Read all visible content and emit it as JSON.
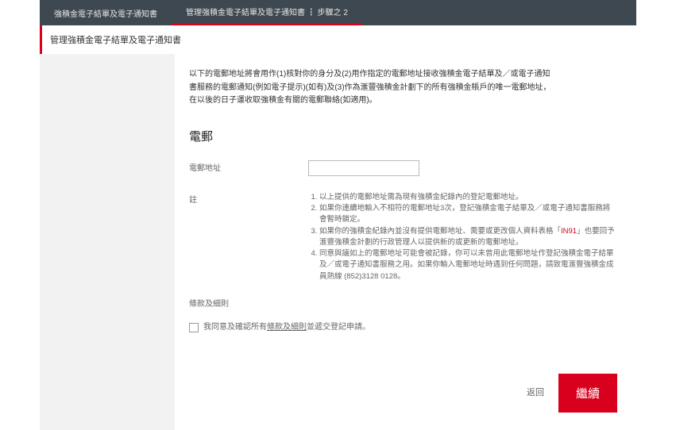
{
  "tabs": [
    {
      "label": "強積金電子結單及電子通知書"
    },
    {
      "label": "管理強積金電子結單及電子通知書 ┇ 步驟之 2"
    }
  ],
  "subheader": "管理強積金電子結單及電子通知書",
  "intro": {
    "line1": "以下的電郵地址將會用作(1)核對你的身分及(2)用作指定的電郵地址接收強積金電子結單及／或電子通知",
    "line2": "書服務的電郵通知(例如電子提示)(如有)及(3)作為滙豐強積金計劃下的所有強積金賬戶的唯一電郵地址，",
    "line3": "在以後的日子運收取強積金有關的電郵聯絡(如適用)。"
  },
  "section_title": "電郵",
  "email_label": "電郵地址",
  "email_value": "",
  "note_label": "註",
  "notes": {
    "n1": "以上提供的電郵地址需為現有強積金紀錄內的登記電郵地址。",
    "n2": "如果你連續地輸入不相符的電郵地址3次，登記強積金電子結單及／或電子通知書服務將會暫時鎖定。",
    "n3_a": "如果你的強積金紀錄內並沒有提供電郵地址、需要或更改個人資料表格「",
    "n3_link": "IN91",
    "n3_b": "」也要回予滙豐強積金計劃的行政管理人以提供新的或更新的電郵地址。",
    "n4": "同意與議如上的電郵地址可能會被記錄，你可以未曾用此電郵地址作登記強積金電子結單及／或電子通知書服務之用。如果你輸入電郵地址時遇到任何問題，請致電滙豐強積金成員熱線 (852)3128 0128。"
  },
  "terms_title": "條款及細則",
  "agree_before": "我同意及確認所有",
  "agree_link": "條款及細則",
  "agree_after": "並遞交登記申請。",
  "back_label": "返回",
  "continue_label": "繼續"
}
